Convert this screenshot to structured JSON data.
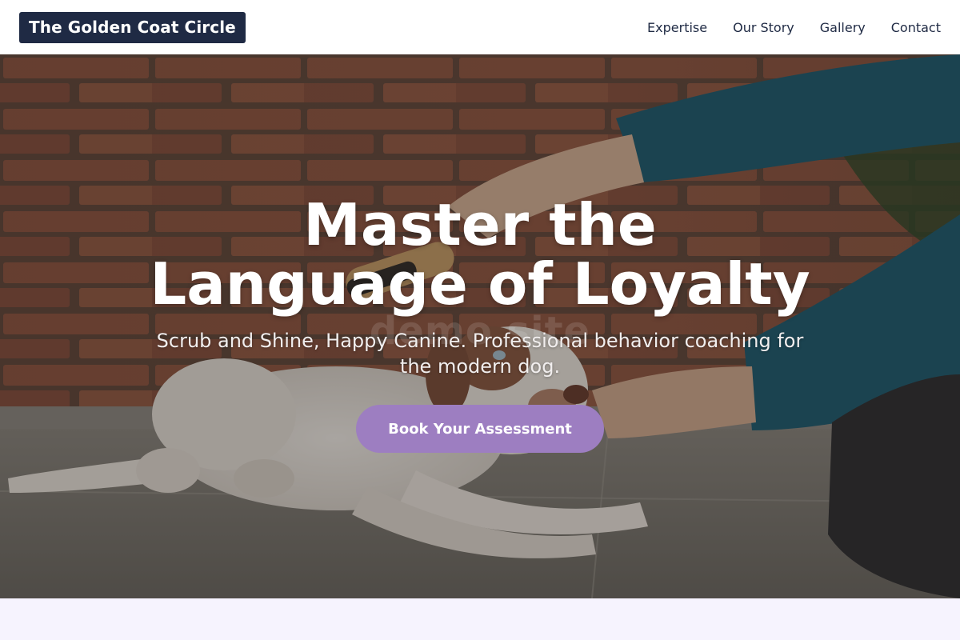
{
  "header": {
    "brand": "The Golden Coat Circle",
    "nav": [
      {
        "label": "Expertise"
      },
      {
        "label": "Our Story"
      },
      {
        "label": "Gallery"
      },
      {
        "label": "Contact"
      }
    ]
  },
  "hero": {
    "title_line1": "Master the",
    "title_line2": "Language of Loyalty",
    "subtitle": "Scrub and Shine, Happy Canine. Professional behavior coaching for the modern dog.",
    "cta_label": "Book Your Assessment",
    "watermark": "demo site",
    "background_image": "person-brushing-dog-photo"
  },
  "colors": {
    "header_bg": "#ffffff",
    "brand_bg": "#1f2a44",
    "nav_text": "#1f2a44",
    "cta_bg": "#9d7ec1",
    "section_bg": "#f6f3fe"
  }
}
